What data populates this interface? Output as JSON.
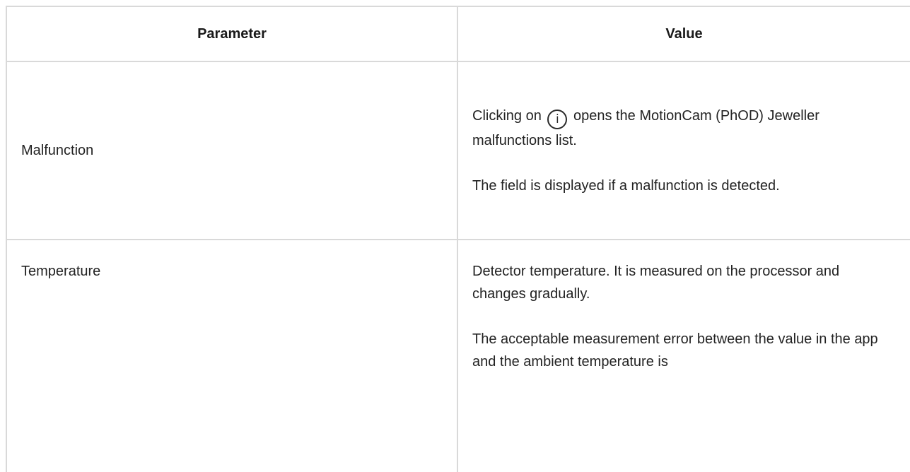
{
  "table": {
    "headers": {
      "parameter": "Parameter",
      "value": "Value"
    },
    "rows": [
      {
        "parameter": "Malfunction",
        "value_part1_before_icon": "Clicking on",
        "icon": "info-icon",
        "icon_glyph": "i",
        "value_part1_after_icon": "opens the MotionCam (PhOD) Jeweller malfunctions list.",
        "value_part2": "The field is displayed if a malfunction is detected."
      },
      {
        "parameter": "Temperature",
        "value_part1": "Detector temperature. It is measured on the processor and changes gradually.",
        "value_part2": "The acceptable measurement error between the value in the app and the ambient temperature is"
      }
    ]
  }
}
